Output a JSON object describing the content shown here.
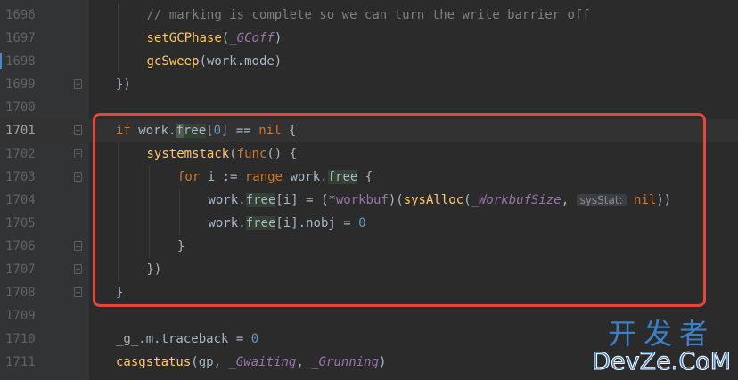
{
  "editor": {
    "lines": [
      {
        "num": "1696",
        "current": false,
        "fold": false,
        "indent": 1,
        "tokens": [
          {
            "t": "// marking is complete so we can turn the write barrier off",
            "c": "cmt"
          }
        ]
      },
      {
        "num": "1697",
        "current": false,
        "fold": false,
        "indent": 1,
        "tokens": [
          {
            "t": "setGCPhase",
            "c": "fn"
          },
          {
            "t": "(",
            "c": ""
          },
          {
            "t": "_GCoff",
            "c": "cst"
          },
          {
            "t": ")",
            "c": ""
          }
        ]
      },
      {
        "num": "1698",
        "current": false,
        "fold": false,
        "indent": 1,
        "tokens": [
          {
            "t": "gcSweep",
            "c": "fn"
          },
          {
            "t": "(work.mode)",
            "c": ""
          }
        ]
      },
      {
        "num": "1699",
        "current": false,
        "fold": true,
        "indent": 0,
        "tokens": [
          {
            "t": "})",
            "c": ""
          }
        ]
      },
      {
        "num": "1700",
        "current": false,
        "fold": false,
        "indent": 0,
        "tokens": []
      },
      {
        "num": "1701",
        "current": true,
        "fold": true,
        "indent": 0,
        "tokens": [
          {
            "t": "if",
            "c": "kw"
          },
          {
            "t": " work.",
            "c": ""
          },
          {
            "t": "f",
            "c": "caret"
          },
          {
            "t": "ree",
            "c": "hl"
          },
          {
            "t": "[",
            "c": ""
          },
          {
            "t": "0",
            "c": "num"
          },
          {
            "t": "] == ",
            "c": ""
          },
          {
            "t": "nil",
            "c": "kw"
          },
          {
            "t": " {",
            "c": ""
          }
        ]
      },
      {
        "num": "1702",
        "current": false,
        "fold": true,
        "indent": 1,
        "tokens": [
          {
            "t": "systemstack",
            "c": "fn"
          },
          {
            "t": "(",
            "c": ""
          },
          {
            "t": "func",
            "c": "kw"
          },
          {
            "t": "() {",
            "c": ""
          }
        ]
      },
      {
        "num": "1703",
        "current": false,
        "fold": true,
        "indent": 2,
        "tokens": [
          {
            "t": "for",
            "c": "kw"
          },
          {
            "t": " i := ",
            "c": ""
          },
          {
            "t": "range",
            "c": "kw"
          },
          {
            "t": " work.",
            "c": ""
          },
          {
            "t": "free",
            "c": "hl"
          },
          {
            "t": " {",
            "c": ""
          }
        ]
      },
      {
        "num": "1704",
        "current": false,
        "fold": false,
        "indent": 3,
        "tokens": [
          {
            "t": "work.",
            "c": ""
          },
          {
            "t": "free",
            "c": "hl"
          },
          {
            "t": "[i] = (*",
            "c": ""
          },
          {
            "t": "workbuf",
            "c": "field"
          },
          {
            "t": ")(",
            "c": ""
          },
          {
            "t": "sysAlloc",
            "c": "fn"
          },
          {
            "t": "(",
            "c": ""
          },
          {
            "t": "_WorkbufSize",
            "c": "cst"
          },
          {
            "t": ", ",
            "c": ""
          },
          {
            "t": "sysStat:",
            "c": "hint"
          },
          {
            "t": " ",
            "c": ""
          },
          {
            "t": "nil",
            "c": "kw"
          },
          {
            "t": "))",
            "c": ""
          }
        ]
      },
      {
        "num": "1705",
        "current": false,
        "fold": false,
        "indent": 3,
        "tokens": [
          {
            "t": "work.",
            "c": ""
          },
          {
            "t": "free",
            "c": "hl"
          },
          {
            "t": "[i].nobj = ",
            "c": ""
          },
          {
            "t": "0",
            "c": "num"
          }
        ]
      },
      {
        "num": "1706",
        "current": false,
        "fold": true,
        "indent": 2,
        "tokens": [
          {
            "t": "}",
            "c": ""
          }
        ]
      },
      {
        "num": "1707",
        "current": false,
        "fold": true,
        "indent": 1,
        "tokens": [
          {
            "t": "})",
            "c": ""
          }
        ]
      },
      {
        "num": "1708",
        "current": false,
        "fold": true,
        "indent": 0,
        "tokens": [
          {
            "t": "}",
            "c": ""
          }
        ]
      },
      {
        "num": "1709",
        "current": false,
        "fold": false,
        "indent": 0,
        "tokens": []
      },
      {
        "num": "1710",
        "current": false,
        "fold": false,
        "indent": 0,
        "tokens": [
          {
            "t": "_g_.m.traceback = ",
            "c": ""
          },
          {
            "t": "0",
            "c": "num"
          }
        ]
      },
      {
        "num": "1711",
        "current": false,
        "fold": false,
        "indent": 0,
        "tokens": [
          {
            "t": "casgstatus",
            "c": "fn"
          },
          {
            "t": "(gp, ",
            "c": ""
          },
          {
            "t": "_Gwaiting",
            "c": "cst"
          },
          {
            "t": ", ",
            "c": ""
          },
          {
            "t": "_Grunning",
            "c": "cst"
          },
          {
            "t": ")",
            "c": ""
          }
        ]
      }
    ]
  },
  "watermark": {
    "chinese": "开发者",
    "latin": "DevZe.CoM"
  },
  "colors": {
    "background": "#2b2b2b",
    "gutter": "#313335",
    "highlight_box": "#e5463e",
    "watermark": "#3d80c6"
  }
}
